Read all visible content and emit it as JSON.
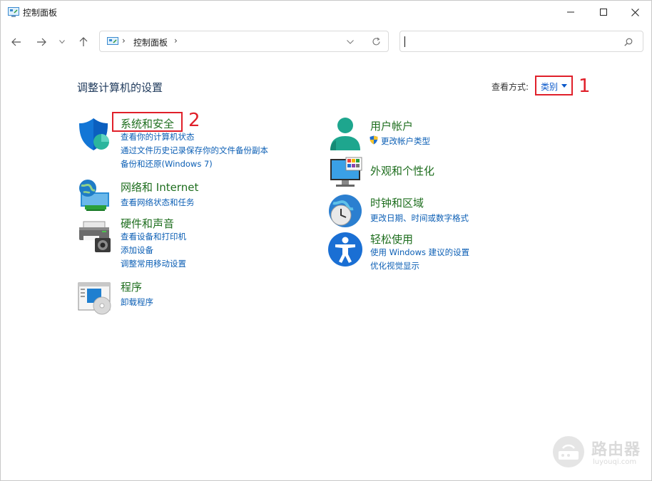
{
  "window": {
    "title": "控制面板"
  },
  "address": {
    "crumb": "控制面板"
  },
  "search": {
    "placeholder": ""
  },
  "header": {
    "title": "调整计算机的设置",
    "view_by_label": "查看方式:",
    "view_by_value": "类别"
  },
  "annotations": {
    "marker_1": "1",
    "marker_2": "2"
  },
  "categories": {
    "system_security": {
      "title": "系统和安全",
      "links": [
        "查看你的计算机状态",
        "通过文件历史记录保存你的文件备份副本",
        "备份和还原(Windows 7)"
      ]
    },
    "network": {
      "title": "网络和 Internet",
      "links": [
        "查看网络状态和任务"
      ]
    },
    "hardware": {
      "title": "硬件和声音",
      "links": [
        "查看设备和打印机",
        "添加设备",
        "调整常用移动设置"
      ]
    },
    "programs": {
      "title": "程序",
      "links": [
        "卸载程序"
      ]
    },
    "user_accounts": {
      "title": "用户帐户",
      "links": [
        "更改帐户类型"
      ]
    },
    "appearance": {
      "title": "外观和个性化",
      "links": []
    },
    "clock_region": {
      "title": "时钟和区域",
      "links": [
        "更改日期、时间或数字格式"
      ]
    },
    "ease_access": {
      "title": "轻松使用",
      "links": [
        "使用 Windows 建议的设置",
        "优化视觉显示"
      ]
    }
  },
  "watermark": {
    "text": "路由器",
    "sub": "luyouqi.com"
  }
}
